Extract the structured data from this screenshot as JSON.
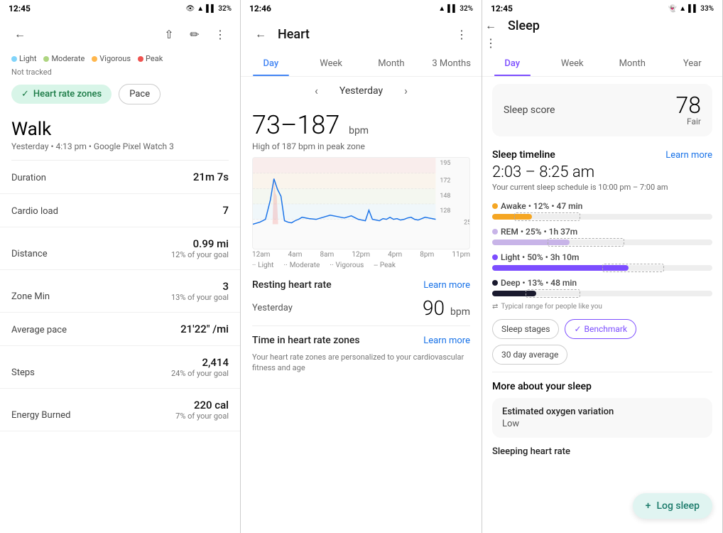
{
  "panel1": {
    "status": {
      "time": "12:45",
      "battery": "32%"
    },
    "legend": [
      {
        "label": "Light",
        "color": "#81d4fa"
      },
      {
        "label": "Moderate",
        "color": "#aed581"
      },
      {
        "label": "Vigorous",
        "color": "#ffb74d"
      },
      {
        "label": "Peak",
        "color": "#ef5350"
      }
    ],
    "not_tracked": "Not tracked",
    "chip_zones": "Heart rate zones",
    "chip_pace": "Pace",
    "activity": "Walk",
    "subtitle": "Yesterday • 4:13 pm • Google Pixel Watch 3",
    "stats": [
      {
        "label": "Duration",
        "value": "21m 7s",
        "sub": ""
      },
      {
        "label": "Cardio load",
        "value": "7",
        "sub": ""
      },
      {
        "label": "Distance",
        "value": "0.99 mi",
        "sub": "12% of your goal"
      },
      {
        "label": "Zone Min",
        "value": "3",
        "sub": "13% of your goal"
      },
      {
        "label": "Average pace",
        "value": "21'22\" /mi",
        "sub": ""
      },
      {
        "label": "Steps",
        "value": "2,414",
        "sub": "24% of your goal"
      },
      {
        "label": "Energy Burned",
        "value": "220 cal",
        "sub": "7% of your goal"
      }
    ]
  },
  "panel2": {
    "status": {
      "time": "12:46",
      "battery": "32%"
    },
    "title": "Heart",
    "tabs": [
      "Day",
      "Week",
      "Month",
      "3 Months"
    ],
    "active_tab": "Day",
    "date_nav": "Yesterday",
    "heart_range": "73–187",
    "heart_unit": "bpm",
    "heart_subtitle": "High of 187 bpm in peak zone",
    "chart": {
      "y_labels": [
        "195",
        "172",
        "148",
        "128"
      ],
      "x_labels": [
        "12am",
        "4am",
        "8am",
        "12pm",
        "4pm",
        "8pm",
        "11pm"
      ],
      "right_label": "25",
      "zones": [
        {
          "label": "Light",
          "style": "dotted"
        },
        {
          "label": "Moderate",
          "style": "dotted"
        },
        {
          "label": "Vigorous",
          "style": "dotted"
        },
        {
          "label": "Peak",
          "style": "dashed"
        }
      ]
    },
    "resting_hr_title": "Resting heart rate",
    "learn_more": "Learn more",
    "yesterday_label": "Yesterday",
    "resting_bpm": "90",
    "resting_unit": "bpm",
    "time_zones_title": "Time in heart rate zones",
    "learn_more2": "Learn more",
    "zones_note": "Your heart rate zones are personalized to your cardiovascular fitness and age"
  },
  "panel3": {
    "status": {
      "time": "12:45",
      "battery": "33%"
    },
    "title": "Sleep",
    "tabs": [
      "Day",
      "Week",
      "Month",
      "Year"
    ],
    "active_tab": "Day",
    "sleep_score_label": "Sleep score",
    "sleep_score": "78",
    "sleep_score_sub": "Fair",
    "timeline_title": "Sleep timeline",
    "learn_more": "Learn more",
    "time_range": "2:03 – 8:25 am",
    "schedule": "Your current sleep schedule is 10:00 pm – 7:00 am",
    "stages": [
      {
        "label": "Awake",
        "pct": "12%",
        "dur": "47 min",
        "color": "#f5a623",
        "fill_pct": 18
      },
      {
        "label": "REM",
        "pct": "25%",
        "dur": "1h 37m",
        "color": "#c8b4e8",
        "fill_pct": 35
      },
      {
        "label": "Light",
        "pct": "50%",
        "dur": "3h 10m",
        "color": "#7c4dff",
        "fill_pct": 62
      },
      {
        "label": "Deep",
        "pct": "13%",
        "dur": "48 min",
        "color": "#1a1a2e",
        "fill_pct": 20
      }
    ],
    "typical_note": "Typical range for people like you",
    "chips": [
      "Sleep stages",
      "Benchmark",
      "30 day average"
    ],
    "active_chip": "Benchmark",
    "more_title": "More about your sleep",
    "oxy_title": "Estimated oxygen variation",
    "oxy_val": "Low",
    "sleeping_hr": "Sleeping heart rate",
    "log_sleep": "Log sleep"
  }
}
